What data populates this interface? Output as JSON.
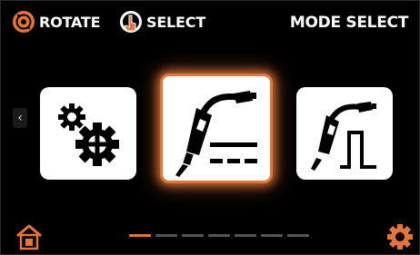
{
  "header": {
    "rotate_label": "ROTATE",
    "select_label": "SELECT",
    "title": "MODE SELECT"
  },
  "icons": {
    "rotate": "rotate-knob-icon",
    "select": "press-knob-icon",
    "left_tile": "settings-gears-icon",
    "center_tile": "mig-torch-continuous-icon",
    "right_tile": "mig-torch-pulse-icon",
    "home": "home-icon",
    "settings": "gear-icon",
    "prev": "chevron-left-icon"
  },
  "nav": {
    "prev_symbol": "‹"
  },
  "pagination": {
    "total": 7,
    "active_index": 0
  },
  "colors": {
    "accent": "#e3753a",
    "background": "#000000",
    "tile": "#ffffff"
  }
}
